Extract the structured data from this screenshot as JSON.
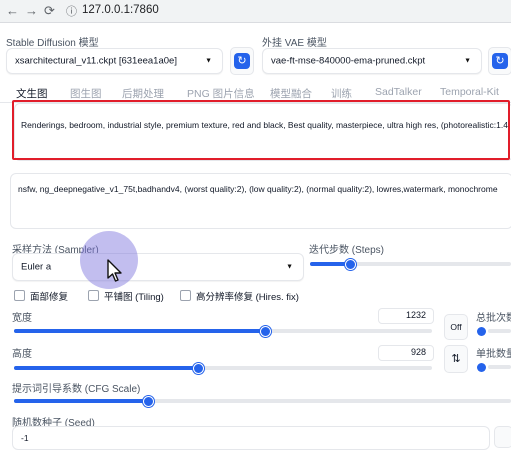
{
  "browser": {
    "url": "127.0.0.1:7860"
  },
  "model": {
    "sd_label": "Stable Diffusion 模型",
    "sd_value": "xsarchitectural_v11.ckpt [631eea1a0e]",
    "vae_label": "外挂 VAE 模型",
    "vae_value": "vae-ft-mse-840000-ema-pruned.ckpt"
  },
  "tabs": [
    "文生图",
    "图生图",
    "后期处理",
    "PNG 图片信息",
    "模型融合",
    "训练",
    "SadTalker",
    "Temporal-Kit"
  ],
  "active_tab": "文生图",
  "prompt": "Renderings, bedroom, industrial style, premium texture, red and black, Best quality, masterpiece, ultra high res, (photorealistic:1.4",
  "negative_prompt": "nsfw, ng_deepnegative_v1_75t,badhandv4, (worst quality:2), (low quality:2), (normal quality:2), lowres,watermark, monochrome",
  "sampler": {
    "label": "采样方法 (Sampler)",
    "value": "Euler a"
  },
  "steps": {
    "label": "迭代步数 (Steps)",
    "fraction": 0.2
  },
  "options": {
    "face_restore": "面部修复",
    "tiling": "平铺图 (Tiling)",
    "hires_fix": "高分辨率修复 (Hires. fix)"
  },
  "width": {
    "label": "宽度",
    "value": "1232",
    "fraction": 0.6
  },
  "height": {
    "label": "高度",
    "value": "928",
    "fraction": 0.44
  },
  "off_button": "Off",
  "swap_icon": "swap-arrows-icon",
  "batch_count_label": "总批次数",
  "batch_size_label": "单批数量",
  "cfg": {
    "label": "提示词引导系数 (CFG Scale)",
    "fraction": 0.27
  },
  "seed": {
    "label": "随机数种子 (Seed)",
    "value": "-1"
  },
  "colors": {
    "accent": "#2563eb",
    "highlight": "#e11d2a"
  }
}
